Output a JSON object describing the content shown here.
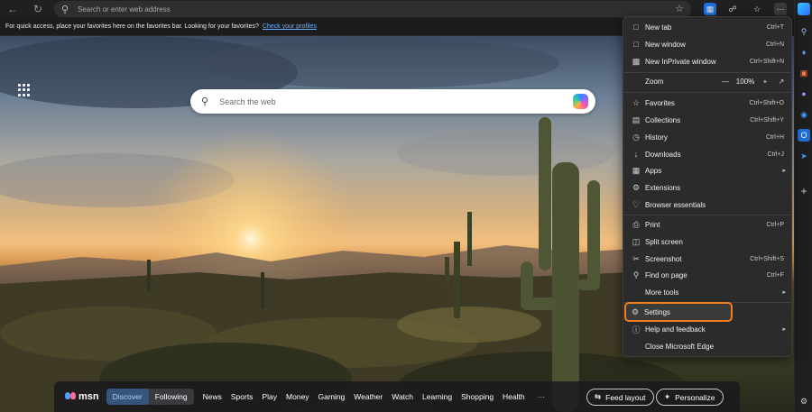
{
  "address_bar": {
    "placeholder": "Search or enter web address"
  },
  "favorites_bar": {
    "message": "For quick access, place your favorites here on the favorites bar. Looking for your favorites?",
    "link": "Check your profiles"
  },
  "hero_search": {
    "placeholder": "Search the web"
  },
  "msn_bar": {
    "logo_text": "msn",
    "tabs": [
      "Discover",
      "Following"
    ],
    "links": [
      "News",
      "Sports",
      "Play",
      "Money",
      "Gaming",
      "Weather",
      "Watch",
      "Learning",
      "Shopping",
      "Health"
    ],
    "more": "···",
    "feed_layout": "Feed layout",
    "personalize": "Personalize"
  },
  "menu": {
    "new_tab": {
      "label": "New tab",
      "shortcut": "Ctrl+T"
    },
    "new_window": {
      "label": "New window",
      "shortcut": "Ctrl+N"
    },
    "new_inprivate": {
      "label": "New InPrivate window",
      "shortcut": "Ctrl+Shift+N"
    },
    "zoom": {
      "label": "Zoom",
      "value": "100%",
      "minus": "—",
      "plus": "+"
    },
    "favorites": {
      "label": "Favorites",
      "shortcut": "Ctrl+Shift+O"
    },
    "collections": {
      "label": "Collections",
      "shortcut": "Ctrl+Shift+Y"
    },
    "history": {
      "label": "History",
      "shortcut": "Ctrl+H"
    },
    "downloads": {
      "label": "Downloads",
      "shortcut": "Ctrl+J"
    },
    "apps": {
      "label": "Apps"
    },
    "extensions": {
      "label": "Extensions"
    },
    "browser_essentials": {
      "label": "Browser essentials"
    },
    "print": {
      "label": "Print",
      "shortcut": "Ctrl+P"
    },
    "split_screen": {
      "label": "Split screen"
    },
    "screenshot": {
      "label": "Screenshot",
      "shortcut": "Ctrl+Shift+S"
    },
    "find_on_page": {
      "label": "Find on page",
      "shortcut": "Ctrl+F"
    },
    "more_tools": {
      "label": "More tools"
    },
    "settings": {
      "label": "Settings"
    },
    "help_feedback": {
      "label": "Help and feedback"
    },
    "close_edge": {
      "label": "Close Microsoft Edge"
    }
  },
  "colors": {
    "highlight": "#f07d1e",
    "accent_blue": "#2d8cff"
  },
  "icons": [
    "back-arrow-icon",
    "refresh-icon",
    "search-icon",
    "star-icon",
    "extension-icon",
    "browser-essentials-icon",
    "favorites-icon",
    "more-icon",
    "copilot-icon",
    "apps-grid-icon",
    "settings-icon"
  ]
}
